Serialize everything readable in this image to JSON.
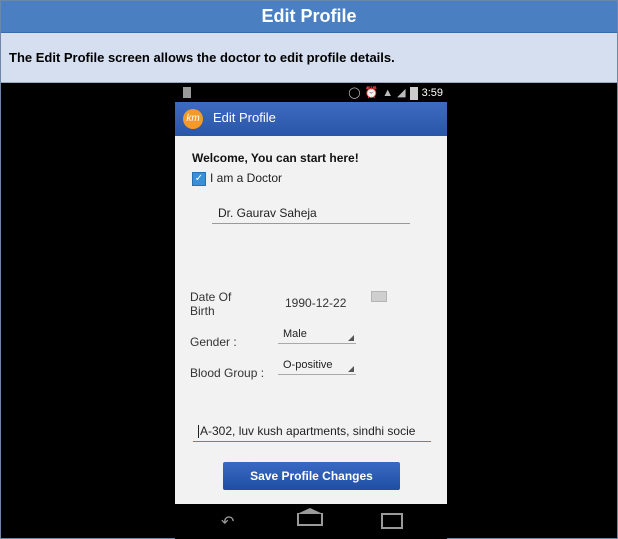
{
  "slide": {
    "title": "Edit Profile",
    "description": "The Edit Profile screen allows the doctor to edit profile details."
  },
  "status_bar": {
    "time": "3:59",
    "icons": [
      "vibrate-icon",
      "alarm-icon",
      "wifi-icon",
      "signal-icon",
      "battery-icon"
    ]
  },
  "action_bar": {
    "logo_text": "km",
    "title": "Edit Profile"
  },
  "form": {
    "welcome": "Welcome, You can start here!",
    "doctor_checkbox_label": "I am a Doctor",
    "doctor_checked": true,
    "name_value": "Dr. Gaurav Saheja",
    "dob_label": "Date Of Birth",
    "dob_value": "1990-12-22",
    "gender_label": "Gender :",
    "gender_value": "Male",
    "blood_group_label": "Blood Group :",
    "blood_group_value": "O-positive",
    "address_value": "A-302, luv kush apartments, sindhi socie",
    "save_button": "Save Profile Changes"
  },
  "colors": {
    "title_bar": "#4a7fc1",
    "desc_bar": "#d5dff0",
    "action_bar": "#2f5cb2",
    "logo": "#f39a2a",
    "save_button": "#2a58b0"
  }
}
